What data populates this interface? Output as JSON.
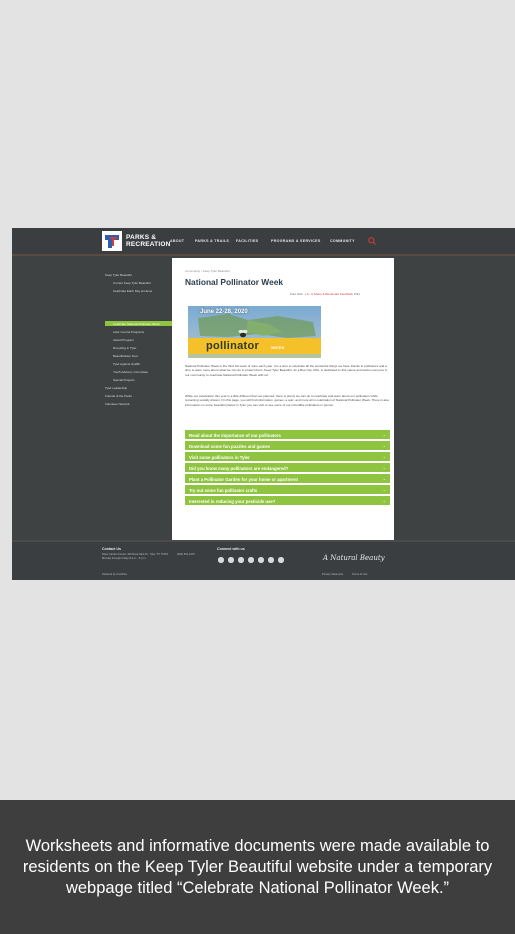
{
  "site": {
    "logo_line1": "PARKS &",
    "logo_line2": "RECREATION",
    "nav": [
      "ABOUT",
      "PARKS & TRAILS",
      "FACILITIES",
      "PROGRAMS & SERVICES",
      "COMMUNITY"
    ],
    "search_icon": "search-icon"
  },
  "sidebar": {
    "items": [
      "Keep Tyler Beautiful",
      "Current Keep Tyler Beautiful",
      "Celebrate Earth Day at Home",
      "Celebrate National Pollinator Week",
      "Litter Control Programs",
      "Award Program",
      "Recycling in Tyler",
      "Beautification Fest",
      "Tyler Against Graffiti",
      "Youth Advisory Committee",
      "Special Projects",
      "Tyler Leadership",
      "Friends of the Parks",
      "Volunteer Network"
    ]
  },
  "content": {
    "breadcrumb": "Community › Keep Tyler Beautiful",
    "title": "National Pollinator Week",
    "share_label": "Font Size:",
    "share_plus": "+ A",
    "share_minus": "- A",
    "share_links": [
      "Share & Bookmark",
      "Feedback",
      "Print"
    ],
    "banner": {
      "date": "June 22-28, 2020",
      "word": "pollinator",
      "week": "WEEK"
    },
    "paragraph1": "National Pollinator Week is the third full week of June each year. It is a time to celebrate all the wonderful things we have thanks to pollinators and a time to learn more about what we can do to protect them. Keep Tyler Beautiful, as a Bee City USA, is dedicated to this cause and works everyone in our community to celebrate National Pollinator Week with us!",
    "paragraph2": "While our celebration this year is a little different than we planned, there is plenty we can do to celebrate and learn about our pollinators while remaining socially distant. On this page, you will find information, games, a quiz, and more all in celebration of National Pollinator Week. There is also information on some beautiful places in Tyler you can visit to see some of our incredible pollinators in person.",
    "accordion": [
      "Read about the importance of our pollinators",
      "Download some fun puzzles and games",
      "Visit some pollinators in Tyler",
      "Did you know many pollinators are endangered?",
      "Plant a Pollinator Garden for your home or apartment",
      "Try out some fun pollinator crafts",
      "Interested in reducing your pesticide use?"
    ]
  },
  "footer": {
    "contact_title": "Contact Us",
    "contact_line1": "Rose Garden Center, 420 Rose Park Dr., Tyler, TX 75702",
    "contact_line2": "Monday through Friday 8 a.m. - 5 p.m.",
    "phone": "(903) 531-1370",
    "connect_title": "Connect with us",
    "social_icons": [
      "facebook-icon",
      "twitter-icon",
      "instagram-icon",
      "youtube-icon",
      "flickr-icon",
      "linkedin-icon",
      "rss-icon"
    ],
    "signature": "A Natural Beauty",
    "powered": "Powered by CivicPlus",
    "links": [
      "Privacy Statement",
      "Terms of Use"
    ]
  },
  "caption": "Worksheets and informative documents were made available to residents on the Keep Tyler Beautiful website under a temporary webpage titled “Celebrate National Pollinator Week.”",
  "colors": {
    "accent_green": "#8fc441",
    "dark_bg": "#3f4243",
    "title_blue": "#2b3e4c",
    "caption_bg": "#3e3e3e"
  }
}
